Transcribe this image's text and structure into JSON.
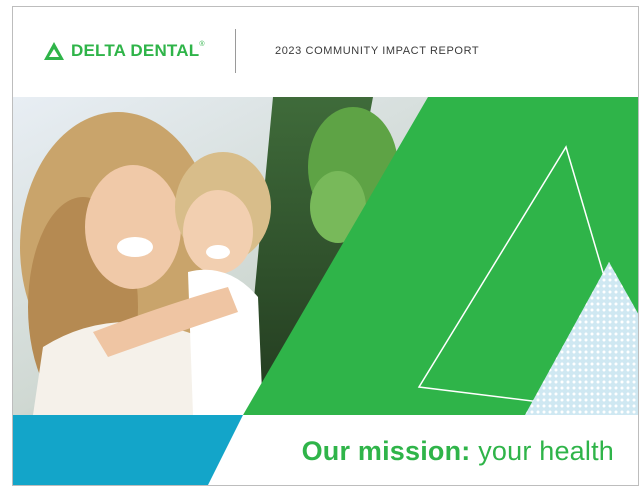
{
  "header": {
    "logo_text": "DELTA DENTAL",
    "logo_registered": "®",
    "report_title": "2023 COMMUNITY IMPACT REPORT"
  },
  "hero": {
    "photo": "mother-and-daughter-piggyback-photo"
  },
  "footer": {
    "tagline_bold": "Our mission:",
    "tagline_light": "your health"
  },
  "colors": {
    "brand_green": "#2fb449",
    "accent_blue": "#13a5c9",
    "text_dark": "#3b3b3b"
  }
}
